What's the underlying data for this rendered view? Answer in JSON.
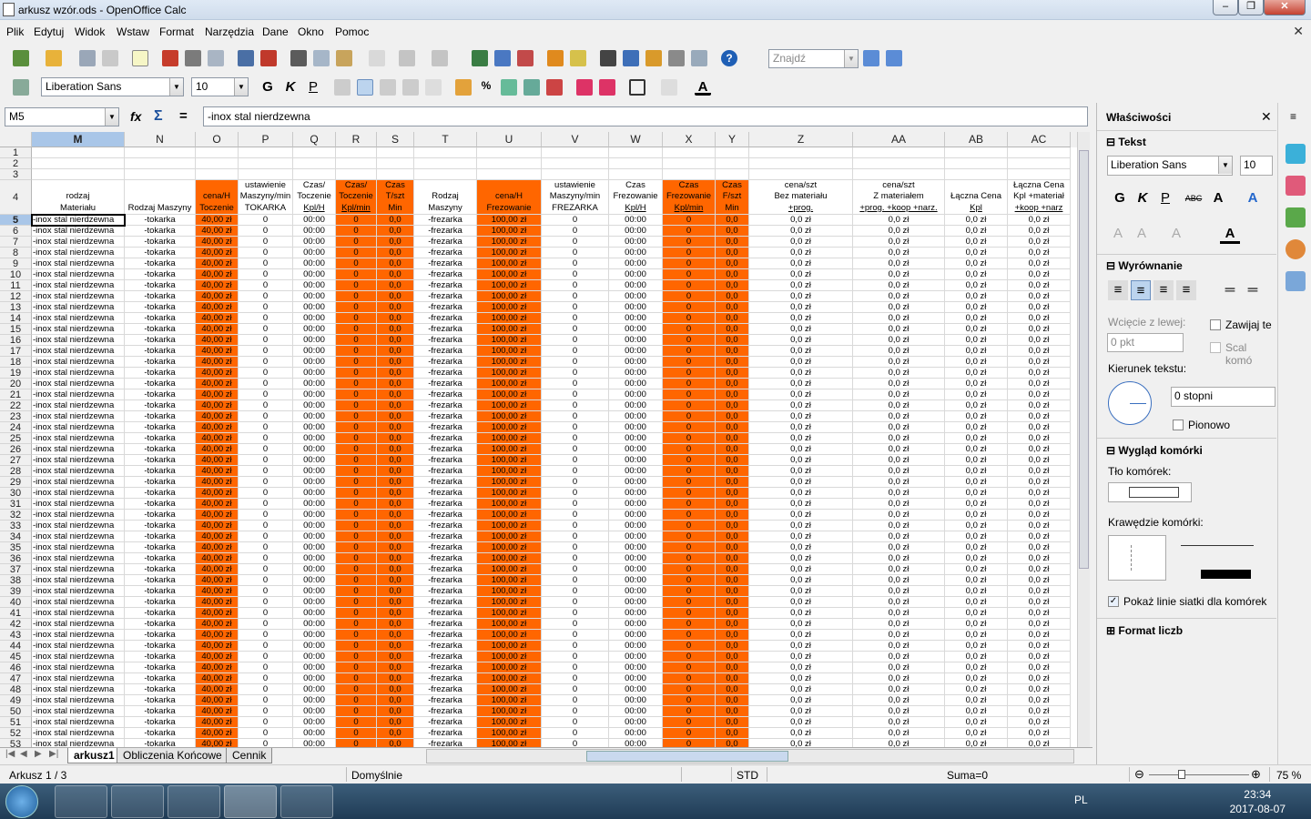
{
  "window": {
    "title": "arkusz wzór.ods - OpenOffice Calc"
  },
  "menu": [
    "Plik",
    "Edytuj",
    "Widok",
    "Wstaw",
    "Format",
    "Narzędzia",
    "Dane",
    "Okno",
    "Pomoc"
  ],
  "toolbar": {
    "search_placeholder": "Znajdź",
    "font_name": "Liberation Sans",
    "font_size": "10"
  },
  "formula": {
    "name_box": "M5",
    "content": "-inox stal nierdzewna",
    "fx": "fx",
    "sum": "Σ",
    "eq": "="
  },
  "columns": [
    "M",
    "N",
    "O",
    "P",
    "Q",
    "R",
    "S",
    "T",
    "U",
    "V",
    "W",
    "X",
    "Y",
    "Z",
    "AA",
    "AB",
    "AC"
  ],
  "header_row": [
    {
      "l1": "",
      "l2": "rodzaj",
      "l3": "Materiału"
    },
    {
      "l1": "",
      "l2": "",
      "l3": "Rodzaj Maszyny"
    },
    {
      "l1": "",
      "l2": "cena/H",
      "l3": "Toczenie"
    },
    {
      "l1": "ustawienie",
      "l2": "Maszyny/min",
      "l3": "TOKARKA"
    },
    {
      "l1": "Czas/",
      "l2": "Toczenie",
      "l3": "Kpl/H"
    },
    {
      "l1": "Czas/",
      "l2": "Toczenie",
      "l3": "Kpl/min"
    },
    {
      "l1": "Czas",
      "l2": "T/szt",
      "l3": "Min"
    },
    {
      "l1": "",
      "l2": "Rodzaj",
      "l3": "Maszyny"
    },
    {
      "l1": "",
      "l2": "cena/H",
      "l3": "Frezowanie"
    },
    {
      "l1": "ustawienie",
      "l2": "Maszyny/min",
      "l3": "FREZARKA"
    },
    {
      "l1": "Czas",
      "l2": "Frezowanie",
      "l3": "Kpl/H"
    },
    {
      "l1": "Czas",
      "l2": "Frezowanie",
      "l3": "Kpl/min"
    },
    {
      "l1": "Czas",
      "l2": "F/szt",
      "l3": "Min"
    },
    {
      "l1": "cena/szt",
      "l2": "Bez materiału",
      "l3": "+prog."
    },
    {
      "l1": "cena/szt",
      "l2": "Z materiałem",
      "l3": "+prog. +koop +narz."
    },
    {
      "l1": "",
      "l2": "Łączna Cena",
      "l3": "Kpl"
    },
    {
      "l1": "Łączna Cena",
      "l2": "Kpl +materiał",
      "l3": "+koop +narz"
    }
  ],
  "row_values": [
    "-inox stal nierdzewna",
    "-tokarka",
    "40,00 zł",
    "0",
    "00:00",
    "0",
    "0,0",
    "-frezarka",
    "100,00 zł",
    "0",
    "00:00",
    "0",
    "0,0",
    "0,0 zł",
    "0,0 zł",
    "0,0 zł",
    "0,0 zł"
  ],
  "row_numbers": [
    "1",
    "2",
    "3",
    "4",
    "5",
    "6",
    "7",
    "8",
    "9",
    "10",
    "11",
    "12",
    "13",
    "14",
    "15",
    "16",
    "17",
    "18",
    "19",
    "20",
    "21",
    "22",
    "23",
    "24",
    "25",
    "26",
    "27",
    "28",
    "29",
    "30",
    "31",
    "32",
    "33",
    "34",
    "35",
    "36",
    "37",
    "38",
    "39",
    "40",
    "41",
    "42",
    "43",
    "44",
    "45",
    "46",
    "47",
    "48",
    "49",
    "50",
    "51",
    "52",
    "53"
  ],
  "sheet_tabs": [
    "arkusz1",
    "Obliczenia Końcowe",
    "Cennik"
  ],
  "status": {
    "sheet": "Arkusz 1 / 3",
    "style": "Domyślnie",
    "mode": "STD",
    "sum": "Suma=0",
    "zoom": "75 %"
  },
  "sidebar": {
    "title": "Właściwości",
    "text_section": "Tekst",
    "font_name": "Liberation Sans",
    "font_size": "10",
    "align_section": "Wyrównanie",
    "indent_label": "Wcięcie z lewej:",
    "indent_value": "0 pkt",
    "wrap": "Zawijaj te",
    "merge": "Scal komó",
    "direction_label": "Kierunek tekstu:",
    "direction_value": "0 stopni",
    "vertical": "Pionowo",
    "cell_section": "Wygląd komórki",
    "bg_label": "Tło komórek:",
    "border_label": "Krawędzie komórki:",
    "gridlines": "Pokaż linie siatki dla komórek",
    "number_section": "Format liczb"
  },
  "taskbar": {
    "lang": "PL",
    "time": "23:34",
    "date": "2017-08-07"
  }
}
